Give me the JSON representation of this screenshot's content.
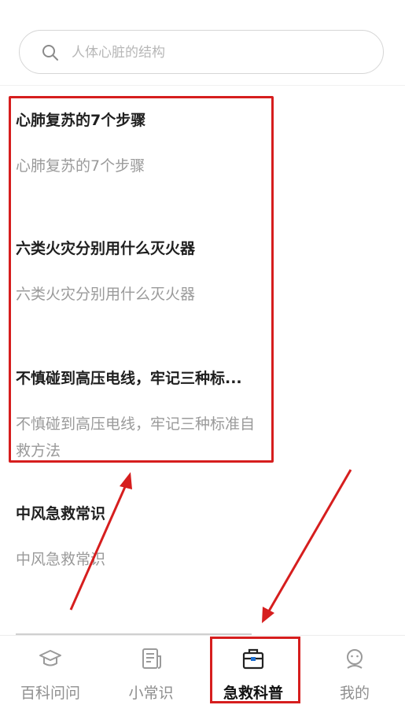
{
  "search": {
    "placeholder": "人体心脏的结构"
  },
  "articles": [
    {
      "title": "心肺复苏的7个步骤",
      "summary": "心肺复苏的7个步骤"
    },
    {
      "title": "六类火灾分别用什么灭火器",
      "summary": "六类火灾分别用什么灭火器"
    },
    {
      "title": "不慎碰到高压电线，牢记三种标...",
      "summary": "不慎碰到高压电线，牢记三种标准自救方法"
    },
    {
      "title": "中风急救常识",
      "summary": "中风急救常识"
    }
  ],
  "tabs": [
    {
      "label": "百科问问",
      "icon": "graduation-cap-icon"
    },
    {
      "label": "小常识",
      "icon": "document-icon"
    },
    {
      "label": "急救科普",
      "icon": "first-aid-kit-icon"
    },
    {
      "label": "我的",
      "icon": "user-face-icon"
    }
  ],
  "colors": {
    "annotation": "#d61e1e",
    "title": "#1f1f1f",
    "summary": "#9a9a9a",
    "tab_inactive": "#8f8f8f"
  }
}
